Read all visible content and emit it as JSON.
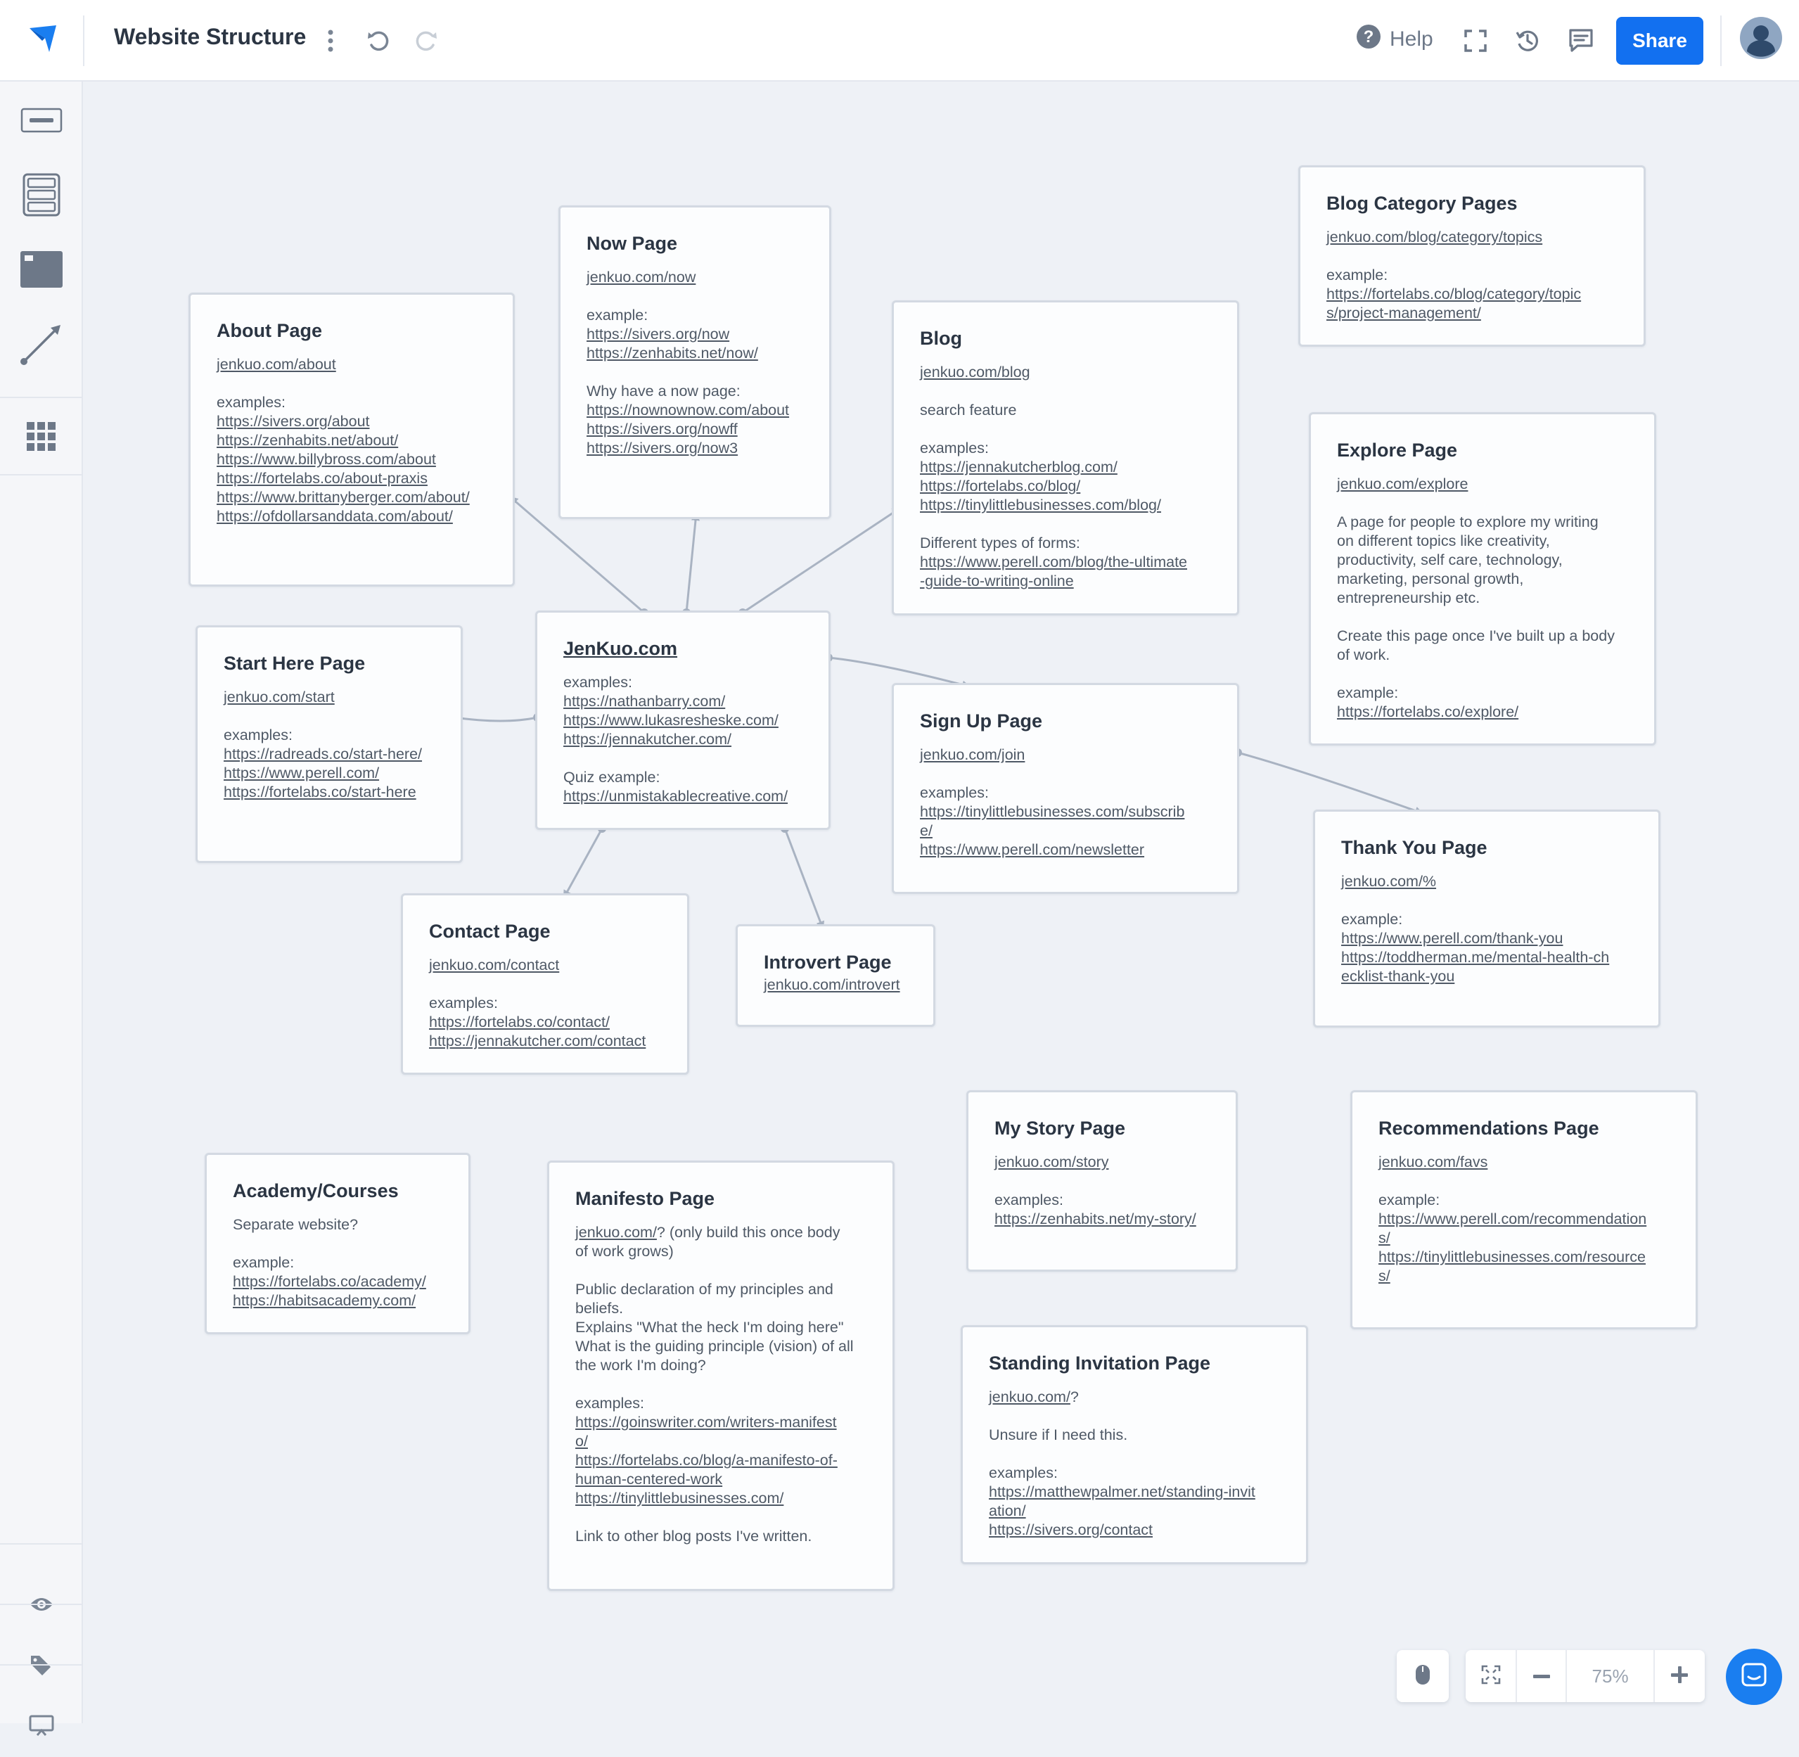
{
  "app": {
    "title": "Website Structure",
    "help_label": "Help",
    "share_label": "Share",
    "zoom_level": "75%",
    "colors": {
      "accent": "#1270f0",
      "chat": "#1a7ef0",
      "connector": "#a9b3c2"
    }
  },
  "toolbar": {
    "icons": [
      "logo-icon",
      "more-vertical-icon",
      "undo-icon",
      "redo-icon",
      "help-icon",
      "fullscreen-icon",
      "history-icon",
      "comment-icon",
      "user-avatar-icon"
    ]
  },
  "sidebar": {
    "items": [
      {
        "icon": "text-block-icon"
      },
      {
        "icon": "section-stack-icon"
      },
      {
        "icon": "image-block-icon"
      },
      {
        "icon": "connector-line-icon"
      },
      {
        "icon": "grid-apps-icon"
      },
      {
        "icon": "eye-icon"
      },
      {
        "icon": "tag-icon"
      },
      {
        "icon": "presentation-icon"
      }
    ]
  },
  "cards": {
    "about": {
      "title": "About Page",
      "url": "jenkuo.com/about",
      "label": "examples:",
      "links": [
        "https://sivers.org/about",
        "https://zenhabits.net/about/",
        "https://www.billybross.com/about",
        "https://fortelabs.co/about-praxis",
        "https://www.brittanyberger.com/about/",
        "https://ofdollarsanddata.com/about/"
      ]
    },
    "now": {
      "title": "Now Page",
      "url": "jenkuo.com/now",
      "label": "example:",
      "links": [
        "https://sivers.org/now",
        "https://zenhabits.net/now/"
      ],
      "label2": "Why have a now page:",
      "links2": [
        "https://nownownow.com/about",
        "https://sivers.org/nowff",
        "https://sivers.org/now3"
      ]
    },
    "blog": {
      "title": "Blog",
      "url": "jenkuo.com/blog",
      "note": "search feature",
      "label": "examples:",
      "links": [
        "https://jennakutcherblog.com/",
        "https://fortelabs.co/blog/",
        "https://tinylittlebusinesses.com/blog/"
      ],
      "label2": "Different types of forms:",
      "links2": [
        "https://www.perell.com/blog/the-ultimate",
        "-guide-to-writing-online"
      ]
    },
    "blog_category": {
      "title": "Blog Category Pages",
      "url": "jenkuo.com/blog/category/topics",
      "label": "example:",
      "links": [
        "https://fortelabs.co/blog/category/topic",
        "s/project-management/"
      ]
    },
    "explore": {
      "title": "Explore Page",
      "url": "jenkuo.com/explore",
      "desc": [
        "A page for people to explore my writing",
        "on different topics like creativity,",
        "productivity, self care, technology,",
        "marketing, personal growth,",
        "entrepreneurship etc."
      ],
      "desc2": [
        "Create this page once I've built up a body",
        "of work."
      ],
      "label": "example:",
      "links": [
        "https://fortelabs.co/explore/"
      ]
    },
    "start": {
      "title": "Start Here Page",
      "url": "jenkuo.com/start",
      "label": "examples:",
      "links": [
        "https://radreads.co/start-here/",
        "https://www.perell.com/",
        "https://fortelabs.co/start-here"
      ]
    },
    "home": {
      "title": "JenKuo.com",
      "label": "examples:",
      "links": [
        "https://nathanbarry.com/",
        "https://www.lukasresheske.com/",
        "https://jennakutcher.com/"
      ],
      "label2": "Quiz example:",
      "links2": [
        "https://unmistakablecreative.com/"
      ]
    },
    "signup": {
      "title": "Sign Up Page",
      "url": "jenkuo.com/join",
      "label": "examples:",
      "links": [
        "https://tinylittlebusinesses.com/subscrib",
        "e/",
        "https://www.perell.com/newsletter"
      ]
    },
    "thankyou": {
      "title": "Thank You Page",
      "url": "jenkuo.com/%",
      "label": "example:",
      "links": [
        "https://www.perell.com/thank-you",
        "https://toddherman.me/mental-health-ch",
        "ecklist-thank-you"
      ]
    },
    "contact": {
      "title": "Contact Page",
      "url": "jenkuo.com/contact",
      "label": "examples:",
      "links": [
        "https://fortelabs.co/contact/",
        "https://jennakutcher.com/contact"
      ]
    },
    "introvert": {
      "title": "Introvert Page",
      "url": "jenkuo.com/introvert"
    },
    "academy": {
      "title": "Academy/Courses",
      "note": "Separate website?",
      "label": "example:",
      "links": [
        "https://fortelabs.co/academy/",
        "https://habitsacademy.com/"
      ]
    },
    "manifesto": {
      "title": "Manifesto Page",
      "url": "jenkuo.com/",
      "url_suffix": "? (only build this once body",
      "url_suffix2": "of work grows)",
      "desc": [
        "Public declaration of my principles and",
        "beliefs.",
        "Explains \"What the heck I'm doing here\"",
        "What is the guiding principle (vision) of all",
        "the work I'm doing?"
      ],
      "label": "examples:",
      "links": [
        "https://goinswriter.com/writers-manifest",
        "o/",
        "https://fortelabs.co/blog/a-manifesto-of-",
        "human-centered-work",
        "https://tinylittlebusinesses.com/"
      ],
      "footer": "Link to other blog posts I've written."
    },
    "mystory": {
      "title": "My Story Page",
      "url": "jenkuo.com/story",
      "label": "examples:",
      "links": [
        "https://zenhabits.net/my-story/"
      ]
    },
    "recommendations": {
      "title": "Recommendations Page",
      "url": "jenkuo.com/favs",
      "label": "example:",
      "links": [
        "https://www.perell.com/recommendation",
        "s/",
        "https://tinylittlebusinesses.com/resource",
        "s/"
      ]
    },
    "standing": {
      "title": "Standing Invitation Page",
      "url": "jenkuo.com/",
      "url_suffix": "?",
      "note": "Unsure if I need this.",
      "label": "examples:",
      "links": [
        "https://matthewpalmer.net/standing-invit",
        "ation/",
        "https://sivers.org/contact"
      ]
    }
  }
}
